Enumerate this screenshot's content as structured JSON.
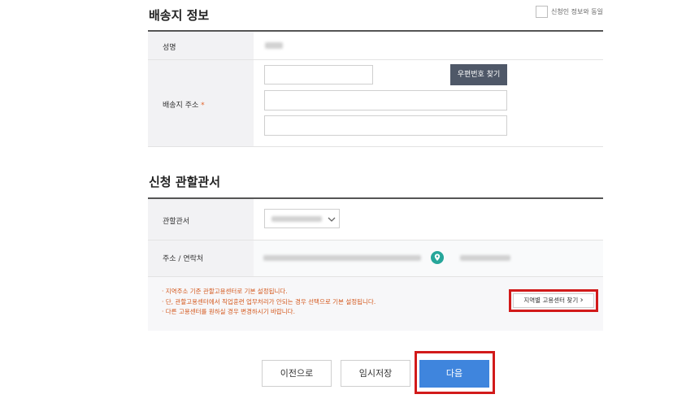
{
  "shipping": {
    "title": "배송지 정보",
    "same_as_applicant_label": "신청인 정보와 동일",
    "name_label": "성명",
    "address_label": "배송지 주소",
    "required_mark": "*",
    "zip_button_label": "우편번호 찾기"
  },
  "office": {
    "title": "신청 관할관서",
    "office_label": "관할관서",
    "address_contact_label": "주소 / 연락처",
    "notices": [
      "· 지역주소 기준 관할고용센터로 기본 설정됩니다.",
      "· 단, 관할고용센터에서 직업훈련 업무처리가 안되는 경우 선택으로 기본 설정됩니다.",
      "· 다른 고용센터를 원하실 경우 변경하시기 바랍니다."
    ],
    "find_center_button_label": "지역별 고용센터 찾기",
    "find_center_chevron": "›"
  },
  "actions": {
    "prev_label": "이전으로",
    "save_label": "임시저장",
    "next_label": "다음"
  },
  "colors": {
    "primary": "#3f85dd",
    "zip_button": "#4f5868",
    "notice": "#d4591e",
    "highlight": "#d21a1a",
    "location_pin": "#26a69a"
  },
  "icons": {
    "location": "location-pin-icon",
    "chevron_down": "chevron-down-icon",
    "chevron_right": "chevron-right-icon"
  }
}
